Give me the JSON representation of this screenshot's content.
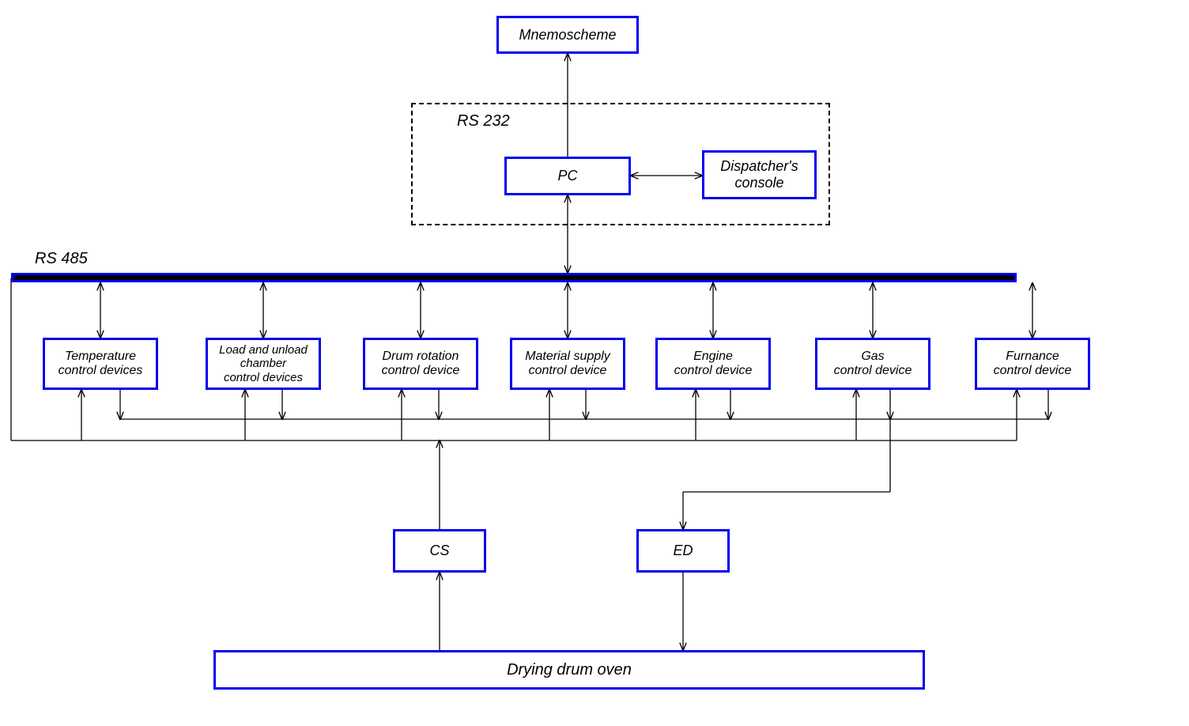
{
  "nodes": {
    "mnemoscheme": "Mnemoscheme",
    "pc": "PC",
    "dispatcher": "Dispatcher's\nconsole",
    "temp": "Temperature\ncontrol devices",
    "load": "Load and unload\nchamber\ncontrol devices",
    "drum": "Drum rotation\ncontrol device",
    "material": "Material supply\ncontrol device",
    "engine": "Engine\ncontrol device",
    "gas": "Gas\ncontrol device",
    "furnace": "Furnance\ncontrol device",
    "cs": "CS",
    "ed": "ED",
    "oven": "Drying drum oven"
  },
  "labels": {
    "rs232": "RS 232",
    "rs485": "RS 485"
  }
}
